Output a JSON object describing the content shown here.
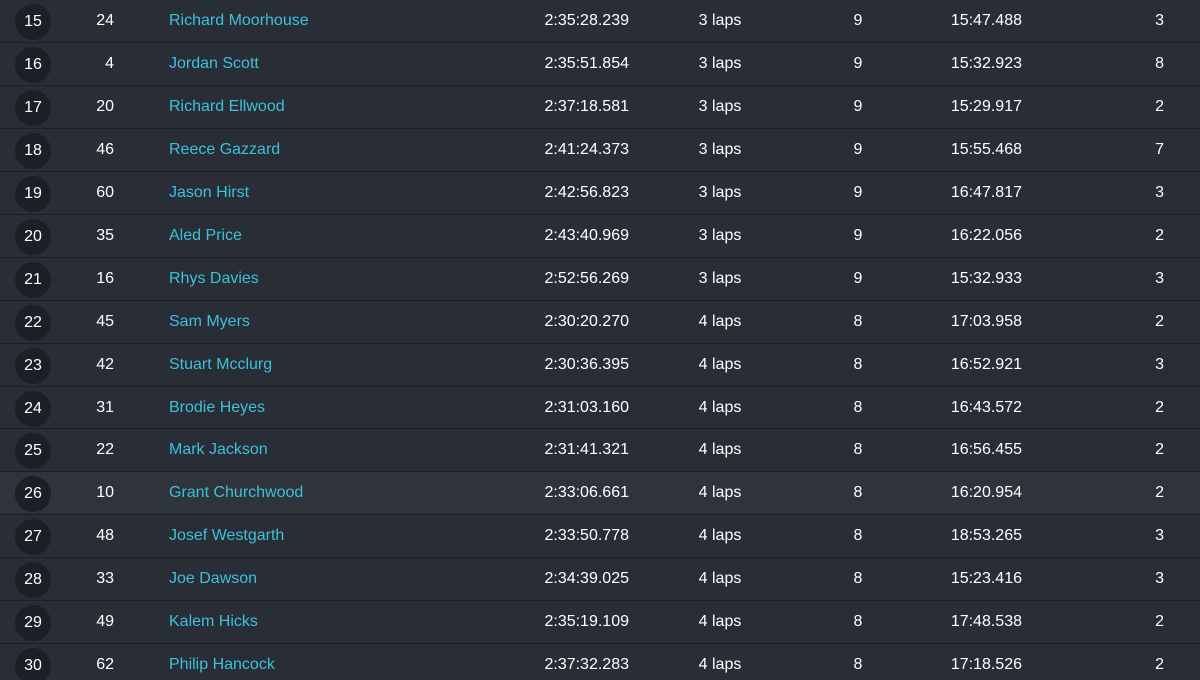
{
  "results": {
    "rows": [
      {
        "pos": "15",
        "num": "24",
        "name": "Richard Moorhouse",
        "time": "2:35:28.239",
        "behind": "3 laps",
        "laps": "9",
        "best_lap": "15:47.488",
        "pits": "3"
      },
      {
        "pos": "16",
        "num": "4",
        "name": "Jordan Scott",
        "time": "2:35:51.854",
        "behind": "3 laps",
        "laps": "9",
        "best_lap": "15:32.923",
        "pits": "8"
      },
      {
        "pos": "17",
        "num": "20",
        "name": "Richard Ellwood",
        "time": "2:37:18.581",
        "behind": "3 laps",
        "laps": "9",
        "best_lap": "15:29.917",
        "pits": "2"
      },
      {
        "pos": "18",
        "num": "46",
        "name": "Reece Gazzard",
        "time": "2:41:24.373",
        "behind": "3 laps",
        "laps": "9",
        "best_lap": "15:55.468",
        "pits": "7"
      },
      {
        "pos": "19",
        "num": "60",
        "name": "Jason Hirst",
        "time": "2:42:56.823",
        "behind": "3 laps",
        "laps": "9",
        "best_lap": "16:47.817",
        "pits": "3"
      },
      {
        "pos": "20",
        "num": "35",
        "name": "Aled Price",
        "time": "2:43:40.969",
        "behind": "3 laps",
        "laps": "9",
        "best_lap": "16:22.056",
        "pits": "2"
      },
      {
        "pos": "21",
        "num": "16",
        "name": "Rhys Davies",
        "time": "2:52:56.269",
        "behind": "3 laps",
        "laps": "9",
        "best_lap": "15:32.933",
        "pits": "3"
      },
      {
        "pos": "22",
        "num": "45",
        "name": "Sam Myers",
        "time": "2:30:20.270",
        "behind": "4 laps",
        "laps": "8",
        "best_lap": "17:03.958",
        "pits": "2"
      },
      {
        "pos": "23",
        "num": "42",
        "name": "Stuart Mcclurg",
        "time": "2:30:36.395",
        "behind": "4 laps",
        "laps": "8",
        "best_lap": "16:52.921",
        "pits": "3"
      },
      {
        "pos": "24",
        "num": "31",
        "name": "Brodie Heyes",
        "time": "2:31:03.160",
        "behind": "4 laps",
        "laps": "8",
        "best_lap": "16:43.572",
        "pits": "2"
      },
      {
        "pos": "25",
        "num": "22",
        "name": "Mark Jackson",
        "time": "2:31:41.321",
        "behind": "4 laps",
        "laps": "8",
        "best_lap": "16:56.455",
        "pits": "2"
      },
      {
        "pos": "26",
        "num": "10",
        "name": "Grant Churchwood",
        "time": "2:33:06.661",
        "behind": "4 laps",
        "laps": "8",
        "best_lap": "16:20.954",
        "pits": "2"
      },
      {
        "pos": "27",
        "num": "48",
        "name": "Josef Westgarth",
        "time": "2:33:50.778",
        "behind": "4 laps",
        "laps": "8",
        "best_lap": "18:53.265",
        "pits": "3"
      },
      {
        "pos": "28",
        "num": "33",
        "name": "Joe Dawson",
        "time": "2:34:39.025",
        "behind": "4 laps",
        "laps": "8",
        "best_lap": "15:23.416",
        "pits": "3"
      },
      {
        "pos": "29",
        "num": "49",
        "name": "Kalem Hicks",
        "time": "2:35:19.109",
        "behind": "4 laps",
        "laps": "8",
        "best_lap": "17:48.538",
        "pits": "2"
      },
      {
        "pos": "30",
        "num": "62",
        "name": "Philip Hancock",
        "time": "2:37:32.283",
        "behind": "4 laps",
        "laps": "8",
        "best_lap": "17:18.526",
        "pits": "2"
      }
    ]
  },
  "colors": {
    "background": "#292d35",
    "badge": "#1c1f25",
    "name_link": "#3cc1db",
    "text": "#ffffff"
  }
}
